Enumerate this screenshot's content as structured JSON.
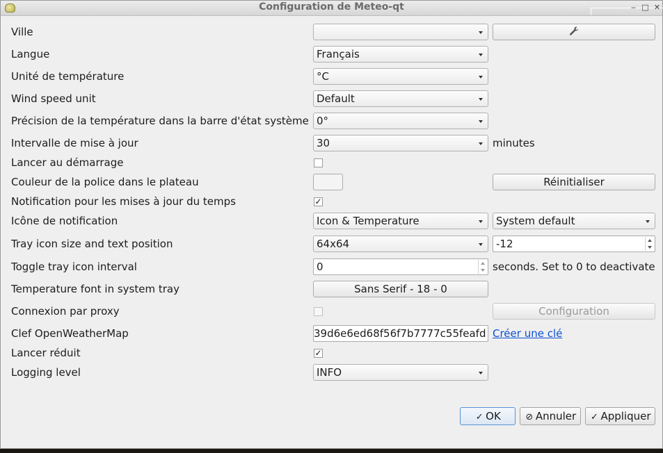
{
  "window": {
    "title": "Configuration de Meteo-qt"
  },
  "labels": {
    "city": "Ville",
    "language": "Langue",
    "temp_unit": "Unité de température",
    "wind_unit": "Wind speed unit",
    "precision": "Précision de la température dans la barre d'état système",
    "interval": "Intervalle de mise à jour",
    "autostart": "Lancer au démarrage",
    "font_color": "Couleur de la police dans le plateau",
    "notification": "Notification pour les mises à jour du temps",
    "notif_icon": "Icône de notification",
    "tray_size": "Tray icon size and text position",
    "toggle_interval": "Toggle tray icon interval",
    "tray_font": "Temperature font in system tray",
    "proxy": "Connexion par proxy",
    "api_key": "Clef OpenWeatherMap",
    "start_minimized": "Lancer réduit",
    "logging": "Logging level"
  },
  "values": {
    "city": "",
    "language": "Français",
    "temp_unit": "°C",
    "wind_unit": "Default",
    "precision": "0°",
    "interval": "30",
    "interval_suffix": "minutes",
    "autostart_checked": false,
    "reset_button": "Réinitialiser",
    "notification_checked": true,
    "notif_icon_mode": "Icon & Temperature",
    "notif_icon_theme": "System default",
    "tray_size": "64x64",
    "tray_position": "-12",
    "toggle_interval": "0",
    "toggle_suffix": "seconds. Set to 0 to deactivate",
    "tray_font": "Sans Serif - 18 - 0",
    "proxy_checked": false,
    "proxy_config_button": "Configuration",
    "api_key": "39d6e6ed68f56f7b7777c55feafd",
    "create_key_link": "Créer une clé",
    "start_minimized_checked": true,
    "logging": "INFO"
  },
  "buttons": {
    "ok": "OK",
    "cancel": "Annuler",
    "apply": "Appliquer"
  },
  "icons": {
    "city_search": "wrench-icon",
    "ok": "checkmark-icon",
    "cancel": "cancel-circle-icon",
    "apply": "checkmark-icon"
  },
  "colors": {
    "link": "#0b4fd6",
    "default_button_border": "#5b8fd6",
    "dialog_bg": "#efefef"
  }
}
